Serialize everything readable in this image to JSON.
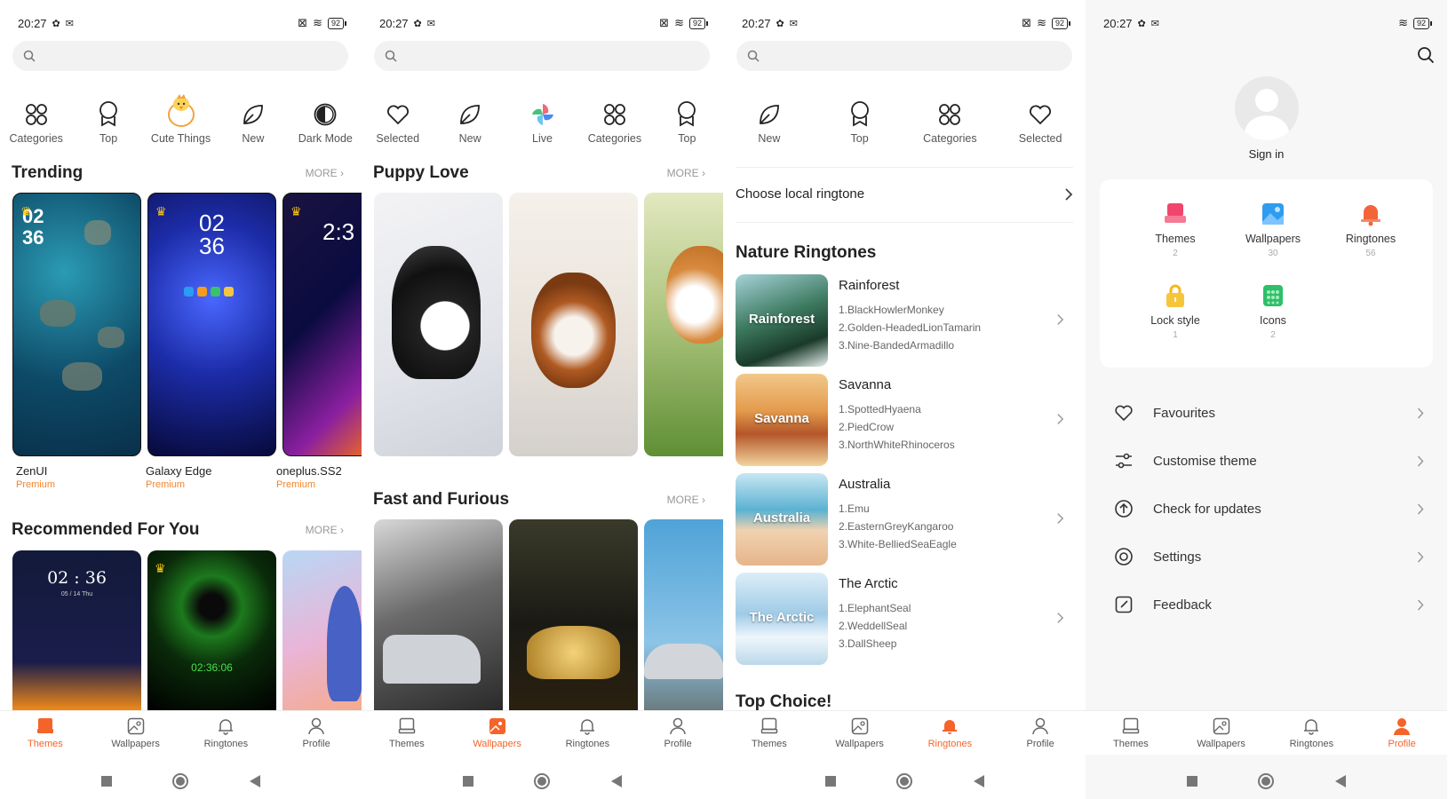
{
  "status": {
    "time": "20:27",
    "battery": "92"
  },
  "screen1": {
    "categories": [
      {
        "label": "Categories",
        "icon": "grid-icon"
      },
      {
        "label": "Top",
        "icon": "badge-icon"
      },
      {
        "label": "Cute Things",
        "icon": "chick-icon"
      },
      {
        "label": "New",
        "icon": "leaf-icon"
      },
      {
        "label": "Dark Mode",
        "icon": "dark-mode-icon"
      }
    ],
    "trending_title": "Trending",
    "more": "MORE",
    "trending": [
      {
        "name": "ZenUI",
        "tag": "Premium",
        "clock": "02\n36"
      },
      {
        "name": "Galaxy Edge",
        "tag": "Premium",
        "clock": "02\n36"
      },
      {
        "name": "oneplus.SS2",
        "tag": "Premium",
        "clock": "2:3"
      }
    ],
    "recommended_title": "Recommended For You",
    "recommended_clock1": "02 : 36",
    "recommended_date1": "05 / 14  Thu",
    "recommended_clock2": "02:36:06"
  },
  "screen2": {
    "categories": [
      {
        "label": "Selected",
        "icon": "heart-icon"
      },
      {
        "label": "New",
        "icon": "leaf-icon"
      },
      {
        "label": "Live",
        "icon": "pinwheel-icon"
      },
      {
        "label": "Categories",
        "icon": "grid-icon"
      },
      {
        "label": "Top",
        "icon": "badge-icon"
      }
    ],
    "section1": "Puppy Love",
    "section2": "Fast and Furious",
    "more": "MORE"
  },
  "screen3": {
    "categories": [
      {
        "label": "New",
        "icon": "leaf-icon"
      },
      {
        "label": "Top",
        "icon": "badge-icon"
      },
      {
        "label": "Categories",
        "icon": "grid-icon"
      },
      {
        "label": "Selected",
        "icon": "heart-icon"
      }
    ],
    "local": "Choose local ringtone",
    "nature_title": "Nature Ringtones",
    "ringtones": [
      {
        "name": "Rainforest",
        "items": [
          "1.BlackHowlerMonkey",
          "2.Golden-HeadedLionTamarin",
          "3.Nine-BandedArmadillo"
        ],
        "color": "#3d6e58"
      },
      {
        "name": "Savanna",
        "items": [
          "1.SpottedHyaena",
          "2.PiedCrow",
          "3.NorthWhiteRhinoceros"
        ],
        "color": "#d88b3f"
      },
      {
        "name": "Australia",
        "items": [
          "1.Emu",
          "2.EasternGreyKangaroo",
          "3.White-BelliedSeaEagle"
        ],
        "color": "#6fb4d0"
      },
      {
        "name": "The Arctic",
        "items": [
          "1.ElephantSeal",
          "2.WeddellSeal",
          "3.DallSheep"
        ],
        "color": "#a9cfe6"
      }
    ],
    "top_choice": "Top Choice!"
  },
  "screen4": {
    "sign_in": "Sign in",
    "grid": [
      {
        "label": "Themes",
        "count": "2",
        "color": "#f0466d"
      },
      {
        "label": "Wallpapers",
        "count": "30",
        "color": "#2f9cf0"
      },
      {
        "label": "Ringtones",
        "count": "56",
        "color": "#f4643a"
      },
      {
        "label": "Lock style",
        "count": "1",
        "color": "#f6b81c"
      },
      {
        "label": "Icons",
        "count": "2",
        "color": "#2fbf68"
      }
    ],
    "menu": [
      {
        "label": "Favourites",
        "icon": "heart-icon"
      },
      {
        "label": "Customise theme",
        "icon": "sliders-icon"
      },
      {
        "label": "Check for updates",
        "icon": "update-icon"
      },
      {
        "label": "Settings",
        "icon": "settings-icon"
      },
      {
        "label": "Feedback",
        "icon": "feedback-icon"
      }
    ]
  },
  "tabs": [
    "Themes",
    "Wallpapers",
    "Ringtones",
    "Profile"
  ],
  "colors": {
    "accent": "#f4642a",
    "premium": "#f4842a"
  }
}
